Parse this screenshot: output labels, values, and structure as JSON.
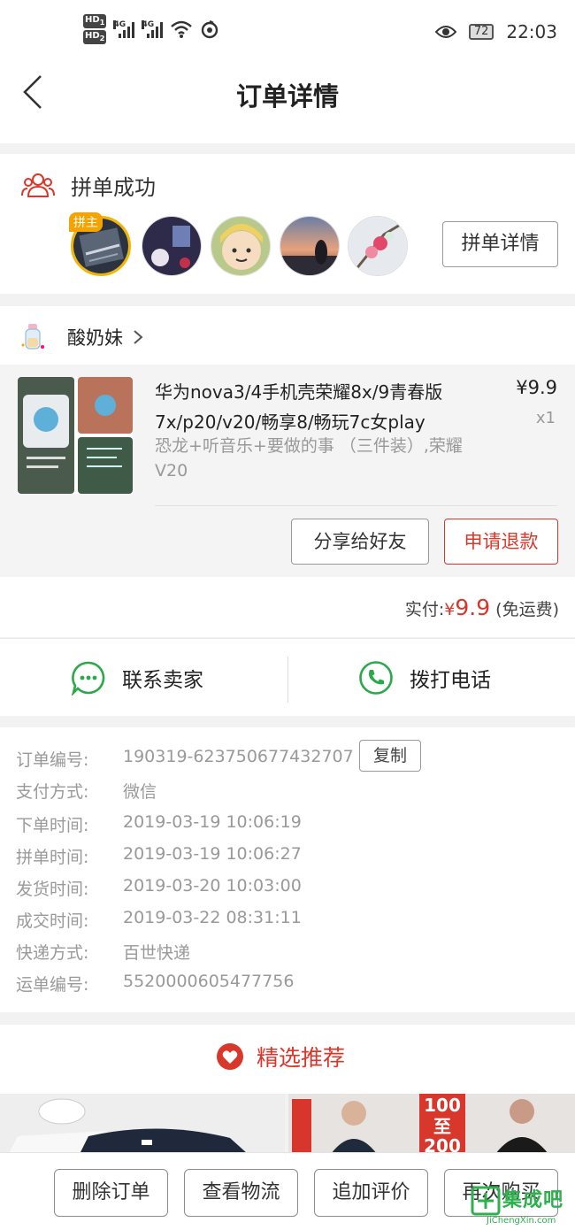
{
  "status_bar": {
    "hd1": "HD",
    "hd1_sub": "1",
    "hd2": "HD",
    "hd2_sub": "2",
    "net1": "4G",
    "net2": "4G",
    "battery": "72",
    "time": "22:03"
  },
  "header": {
    "title": "订单详情",
    "back_icon": "chevron-left-icon"
  },
  "group": {
    "status": "拼单成功",
    "host_badge": "拼主",
    "detail_button": "拼单详情",
    "member_count": 5
  },
  "shop": {
    "name": "酸奶妹"
  },
  "product": {
    "title": "华为nova3/4手机壳荣耀8x/9青春版7x/p20/v20/畅享8/畅玩7c女play",
    "spec": "恐龙+听音乐+要做的事 （三件装）,荣耀V20",
    "price": "¥9.9",
    "qty": "x1",
    "share_button": "分享给好友",
    "refund_button": "申请退款"
  },
  "payment": {
    "label": "实付:",
    "currency": "¥",
    "amount": "9.9",
    "shipping": "(免运费)"
  },
  "contact": {
    "seller": "联系卖家",
    "phone": "拨打电话"
  },
  "order_info": {
    "copy_button": "复制",
    "rows": [
      {
        "label": "订单编号:",
        "value": "190319-623750677432707"
      },
      {
        "label": "支付方式:",
        "value": "微信"
      },
      {
        "label": "下单时间:",
        "value": "2019-03-19 10:06:19"
      },
      {
        "label": "拼单时间:",
        "value": "2019-03-19 10:06:27"
      },
      {
        "label": "发货时间:",
        "value": "2019-03-20 10:03:00"
      },
      {
        "label": "成交时间:",
        "value": "2019-03-22 08:31:11"
      },
      {
        "label": "快递方式:",
        "value": "百世快递"
      },
      {
        "label": "运单编号:",
        "value": "5520000605477756"
      }
    ]
  },
  "recommend": {
    "title": "精选推荐",
    "promo_top": "100",
    "promo_mid": "至",
    "promo_bottom": "200"
  },
  "bottom_bar": {
    "delete": "删除订单",
    "logistics": "查看物流",
    "review": "追加评价",
    "rebuy": "再次购买"
  },
  "watermark": {
    "text": "集成吧",
    "sub": "JiChengXin.com"
  },
  "colors": {
    "accent_red": "#d8372b",
    "contact_green": "#2aa84a",
    "host_badge": "#f5a300"
  }
}
